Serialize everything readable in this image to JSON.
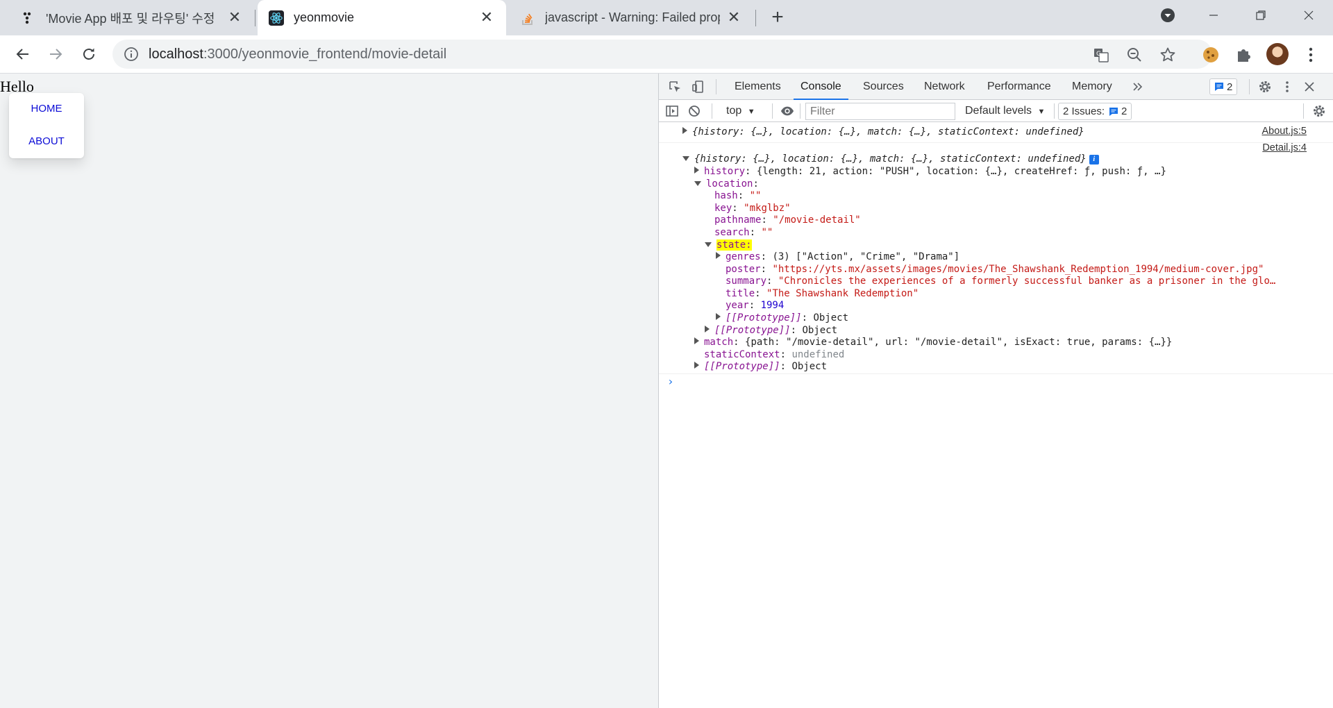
{
  "browser": {
    "tabs": [
      {
        "title": "'Movie App 배포 및 라우팅' 수정",
        "active": false
      },
      {
        "title": "yeonmovie",
        "active": true
      },
      {
        "title": "javascript - Warning: Failed prop",
        "active": false
      }
    ],
    "url_host": "localhost",
    "url_path": ":3000/yeonmovie_frontend/movie-detail"
  },
  "page": {
    "hello": "Hello",
    "nav": {
      "home": "HOME",
      "about": "ABOUT"
    }
  },
  "devtools": {
    "tabs": [
      "Elements",
      "Console",
      "Sources",
      "Network",
      "Performance",
      "Memory"
    ],
    "active_tab": "Console",
    "message_count": "2",
    "context": "top",
    "filter_placeholder": "Filter",
    "levels": "Default levels",
    "issues_label": "2 Issues:",
    "issues_count": "2"
  },
  "console": {
    "msg1": {
      "summary": "{history: {…}, location: {…}, match: {…}, staticContext: undefined}",
      "source": "About.js:5"
    },
    "msg2": {
      "summary": "{history: {…}, location: {…}, match: {…}, staticContext: undefined}",
      "source": "Detail.js:4",
      "history": "{length: 21, action: \"PUSH\", location: {…}, createHref: ƒ, push: ƒ, …}",
      "location": {
        "hash": "\"\"",
        "key": "\"mkglbz\"",
        "pathname": "\"/movie-detail\"",
        "search": "\"\"",
        "state": {
          "genres": "(3) [\"Action\", \"Crime\", \"Drama\"]",
          "poster": "\"https://yts.mx/assets/images/movies/The_Shawshank_Redemption_1994/medium-cover.jpg\"",
          "summary": "\"Chronicles the experiences of a formerly successful banker as a prisoner in the glo…",
          "title": "\"The Shawshank Redemption\"",
          "year": "1994",
          "prototype": "Object"
        },
        "prototype": "Object"
      },
      "match": "{path: \"/movie-detail\", url: \"/movie-detail\", isExact: true, params: {…}}",
      "staticContext": "undefined",
      "prototype": "Object"
    }
  },
  "colors": {
    "accent": "#1a73e8",
    "highlight": "#ffff00",
    "link": "#0b0bd6"
  }
}
